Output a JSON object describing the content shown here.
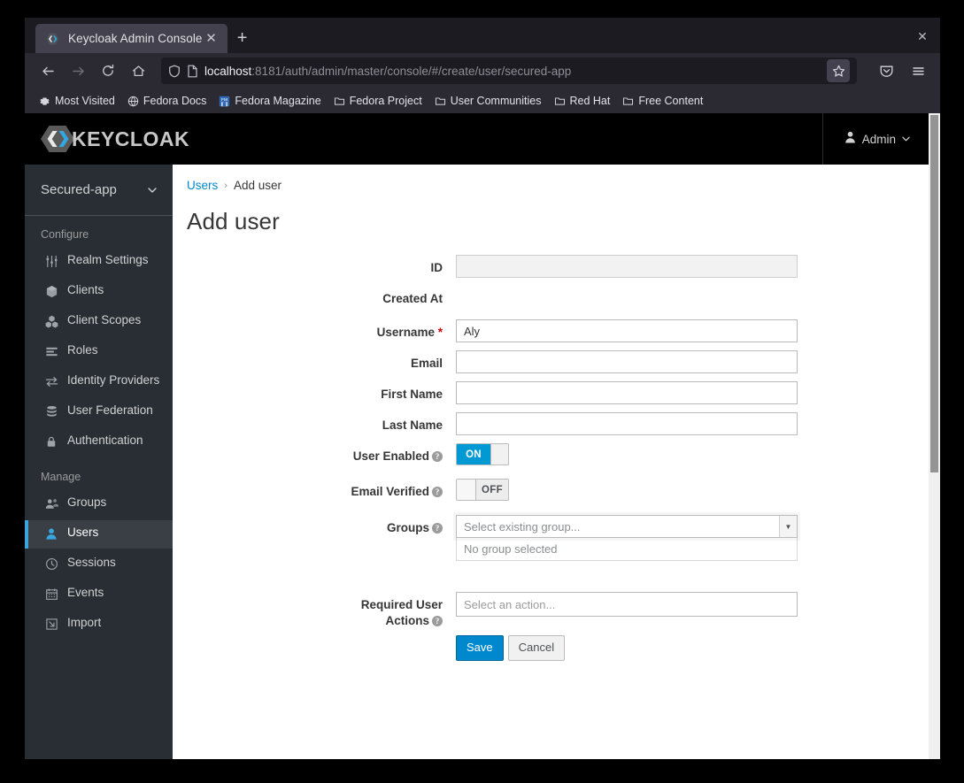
{
  "browser": {
    "tab": {
      "title": "Keycloak Admin Console",
      "favicon": "keycloak-favicon",
      "close": "✕"
    },
    "new_tab": "+",
    "window_close": "✕",
    "nav": {
      "back": "←",
      "forward": "→",
      "reload": "↻",
      "home": "⌂"
    },
    "url": {
      "host": "localhost",
      "rest": ":8181/auth/admin/master/console/#/create/user/secured-app"
    },
    "bookmarks": [
      {
        "label": "Most Visited",
        "icon": "star-gear-icon"
      },
      {
        "label": "Fedora Docs",
        "icon": "globe-icon"
      },
      {
        "label": "Fedora Magazine",
        "icon": "fm-icon"
      },
      {
        "label": "Fedora Project",
        "icon": "folder-icon"
      },
      {
        "label": "User Communities",
        "icon": "folder-icon"
      },
      {
        "label": "Red Hat",
        "icon": "folder-icon"
      },
      {
        "label": "Free Content",
        "icon": "folder-icon"
      }
    ]
  },
  "masthead": {
    "brand": "KEYCLOAK",
    "account_label": "Admin",
    "account_caret": "⌄"
  },
  "sidebar": {
    "realm": {
      "name": "Secured-app",
      "caret": "⌄"
    },
    "sections": [
      {
        "title": "Configure",
        "items": [
          {
            "label": "Realm Settings",
            "icon": "sliders-icon",
            "active": false
          },
          {
            "label": "Clients",
            "icon": "cube-icon",
            "active": false
          },
          {
            "label": "Client Scopes",
            "icon": "cubes-icon",
            "active": false
          },
          {
            "label": "Roles",
            "icon": "list-icon",
            "active": false
          },
          {
            "label": "Identity Providers",
            "icon": "exchange-icon",
            "active": false
          },
          {
            "label": "User Federation",
            "icon": "database-icon",
            "active": false
          },
          {
            "label": "Authentication",
            "icon": "lock-icon",
            "active": false
          }
        ]
      },
      {
        "title": "Manage",
        "items": [
          {
            "label": "Groups",
            "icon": "users-icon",
            "active": false
          },
          {
            "label": "Users",
            "icon": "user-icon",
            "active": true
          },
          {
            "label": "Sessions",
            "icon": "clock-icon",
            "active": false
          },
          {
            "label": "Events",
            "icon": "calendar-icon",
            "active": false
          },
          {
            "label": "Import",
            "icon": "import-icon",
            "active": false
          }
        ]
      }
    ]
  },
  "content": {
    "breadcrumb": {
      "parent": "Users",
      "separator": "›",
      "current": "Add user"
    },
    "title": "Add user",
    "form": {
      "id": {
        "label": "ID",
        "value": "",
        "readonly": true
      },
      "created_at": {
        "label": "Created At",
        "value": ""
      },
      "username": {
        "label": "Username",
        "required_marker": "*",
        "value": "Aly"
      },
      "email": {
        "label": "Email",
        "value": ""
      },
      "first_name": {
        "label": "First Name",
        "value": ""
      },
      "last_name": {
        "label": "Last Name",
        "value": ""
      },
      "user_enabled": {
        "label": "User Enabled",
        "help": "?",
        "state": "ON",
        "on_text": "ON"
      },
      "email_verified": {
        "label": "Email Verified",
        "help": "?",
        "state": "OFF",
        "off_text": "OFF"
      },
      "groups": {
        "label": "Groups",
        "help": "?",
        "placeholder": "Select existing group...",
        "caret": "▼",
        "empty_text": "No group selected"
      },
      "required_user_actions": {
        "label_line1": "Required User",
        "label_line2": "Actions",
        "help": "?",
        "placeholder": "Select an action..."
      }
    },
    "actions": {
      "save": "Save",
      "cancel": "Cancel"
    }
  },
  "colors": {
    "accent_blue": "#0088ce",
    "toggle_on": "#0099d3",
    "sidebar_bg": "#292e34",
    "sidebar_active_bg": "#393f44",
    "sidebar_active_border": "#39a5dc",
    "required_red": "#cc0000",
    "masthead_bg": "#000000"
  }
}
